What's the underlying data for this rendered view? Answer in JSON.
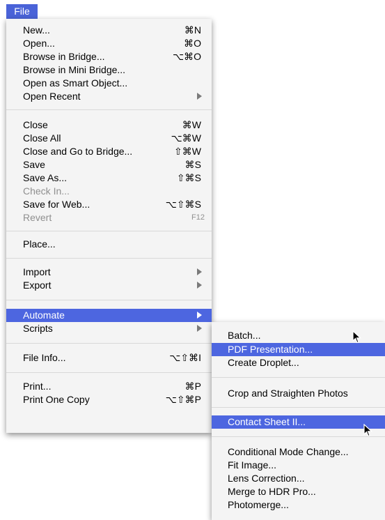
{
  "menubar": {
    "file_label": "File"
  },
  "file_menu": {
    "new": {
      "label": "New...",
      "shortcut": "⌘N"
    },
    "open": {
      "label": "Open...",
      "shortcut": "⌘O"
    },
    "browse_bridge": {
      "label": "Browse in Bridge...",
      "shortcut": "⌥⌘O"
    },
    "browse_mini_bridge": {
      "label": "Browse in Mini Bridge..."
    },
    "open_smart_object": {
      "label": "Open as Smart Object..."
    },
    "open_recent": {
      "label": "Open Recent"
    },
    "close": {
      "label": "Close",
      "shortcut": "⌘W"
    },
    "close_all": {
      "label": "Close All",
      "shortcut": "⌥⌘W"
    },
    "close_go_bridge": {
      "label": "Close and Go to Bridge...",
      "shortcut": "⇧⌘W"
    },
    "save": {
      "label": "Save",
      "shortcut": "⌘S"
    },
    "save_as": {
      "label": "Save As...",
      "shortcut": "⇧⌘S"
    },
    "check_in": {
      "label": "Check In..."
    },
    "save_for_web": {
      "label": "Save for Web...",
      "shortcut": "⌥⇧⌘S"
    },
    "revert": {
      "label": "Revert",
      "shortcut": "F12"
    },
    "place": {
      "label": "Place..."
    },
    "import": {
      "label": "Import"
    },
    "export": {
      "label": "Export"
    },
    "automate": {
      "label": "Automate"
    },
    "scripts": {
      "label": "Scripts"
    },
    "file_info": {
      "label": "File Info...",
      "shortcut": "⌥⇧⌘I"
    },
    "print": {
      "label": "Print...",
      "shortcut": "⌘P"
    },
    "print_one_copy": {
      "label": "Print One Copy",
      "shortcut": "⌥⇧⌘P"
    }
  },
  "automate_menu": {
    "batch": "Batch...",
    "pdf_presentation": "PDF Presentation...",
    "create_droplet": "Create Droplet...",
    "crop_straighten": "Crop and Straighten Photos",
    "contact_sheet": "Contact Sheet II...",
    "conditional_mode": "Conditional Mode Change...",
    "fit_image": "Fit Image...",
    "lens_correction": "Lens Correction...",
    "merge_hdr": "Merge to HDR Pro...",
    "photomerge": "Photomerge..."
  },
  "colors": {
    "highlight": "#4d66e0",
    "menu_bg": "#f4f4f4",
    "disabled_text": "#8f8f8f"
  }
}
